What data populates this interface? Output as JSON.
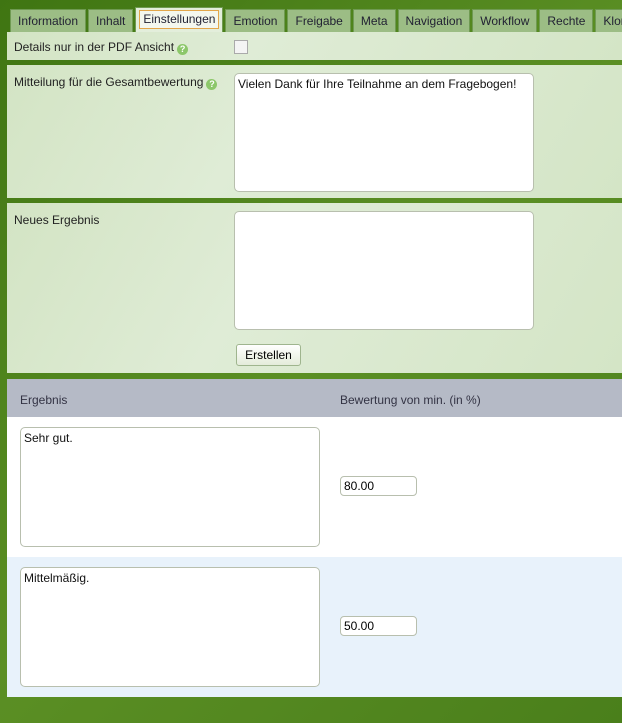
{
  "tabs": [
    "Information",
    "Inhalt",
    "Einstellungen",
    "Emotion",
    "Freigabe",
    "Meta",
    "Navigation",
    "Workflow",
    "Rechte",
    "Klone"
  ],
  "active_tab": "Einstellungen",
  "pdf_details": {
    "label": "Details nur in der PDF Ansicht",
    "help": "?",
    "checked": false
  },
  "message": {
    "label": "Mitteilung für die Gesamtbewertung",
    "help": "?",
    "value": "Vielen Dank für Ihre Teilnahme an dem Fragebogen!"
  },
  "new_result": {
    "label": "Neues Ergebnis",
    "value": "",
    "button": "Erstellen"
  },
  "table": {
    "headers": [
      "Ergebnis",
      "Bewertung von min. (in %)"
    ],
    "rows": [
      {
        "text": "Sehr gut.",
        "min": "80.00"
      },
      {
        "text": "Mittelmäßig.",
        "min": "50.00"
      }
    ]
  }
}
